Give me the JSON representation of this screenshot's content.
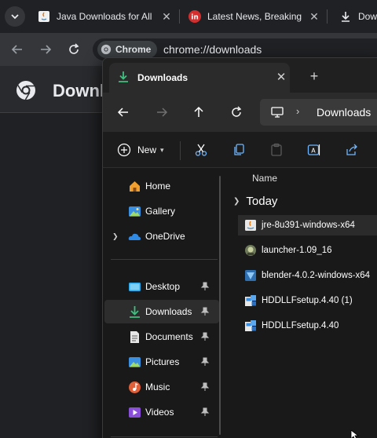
{
  "chrome": {
    "tabs": [
      {
        "title": "Java Downloads for All"
      },
      {
        "title": "Latest News, Breaking"
      },
      {
        "title": "Dow"
      }
    ],
    "omnibox": {
      "chip_label": "Chrome",
      "url": "chrome://downloads"
    },
    "page_title": "Downlo"
  },
  "explorer": {
    "tab_title": "Downloads",
    "breadcrumb": "Downloads",
    "new_label": "New",
    "nav_items": [
      {
        "label": "Home"
      },
      {
        "label": "Gallery"
      },
      {
        "label": "OneDrive"
      },
      {
        "label": "Desktop"
      },
      {
        "label": "Downloads"
      },
      {
        "label": "Documents"
      },
      {
        "label": "Pictures"
      },
      {
        "label": "Music"
      },
      {
        "label": "Videos"
      }
    ],
    "column_name": "Name",
    "group": "Today",
    "files": [
      {
        "name": "jre-8u391-windows-x64"
      },
      {
        "name": "launcher-1.09_16"
      },
      {
        "name": "blender-4.0.2-windows-x64"
      },
      {
        "name": "HDDLLFsetup.4.40 (1)"
      },
      {
        "name": "HDDLLFsetup.4.40"
      }
    ]
  },
  "colors": {
    "accent": "#4cc2ff",
    "chrome_bg": "#202124",
    "explorer_bg": "#191919"
  }
}
